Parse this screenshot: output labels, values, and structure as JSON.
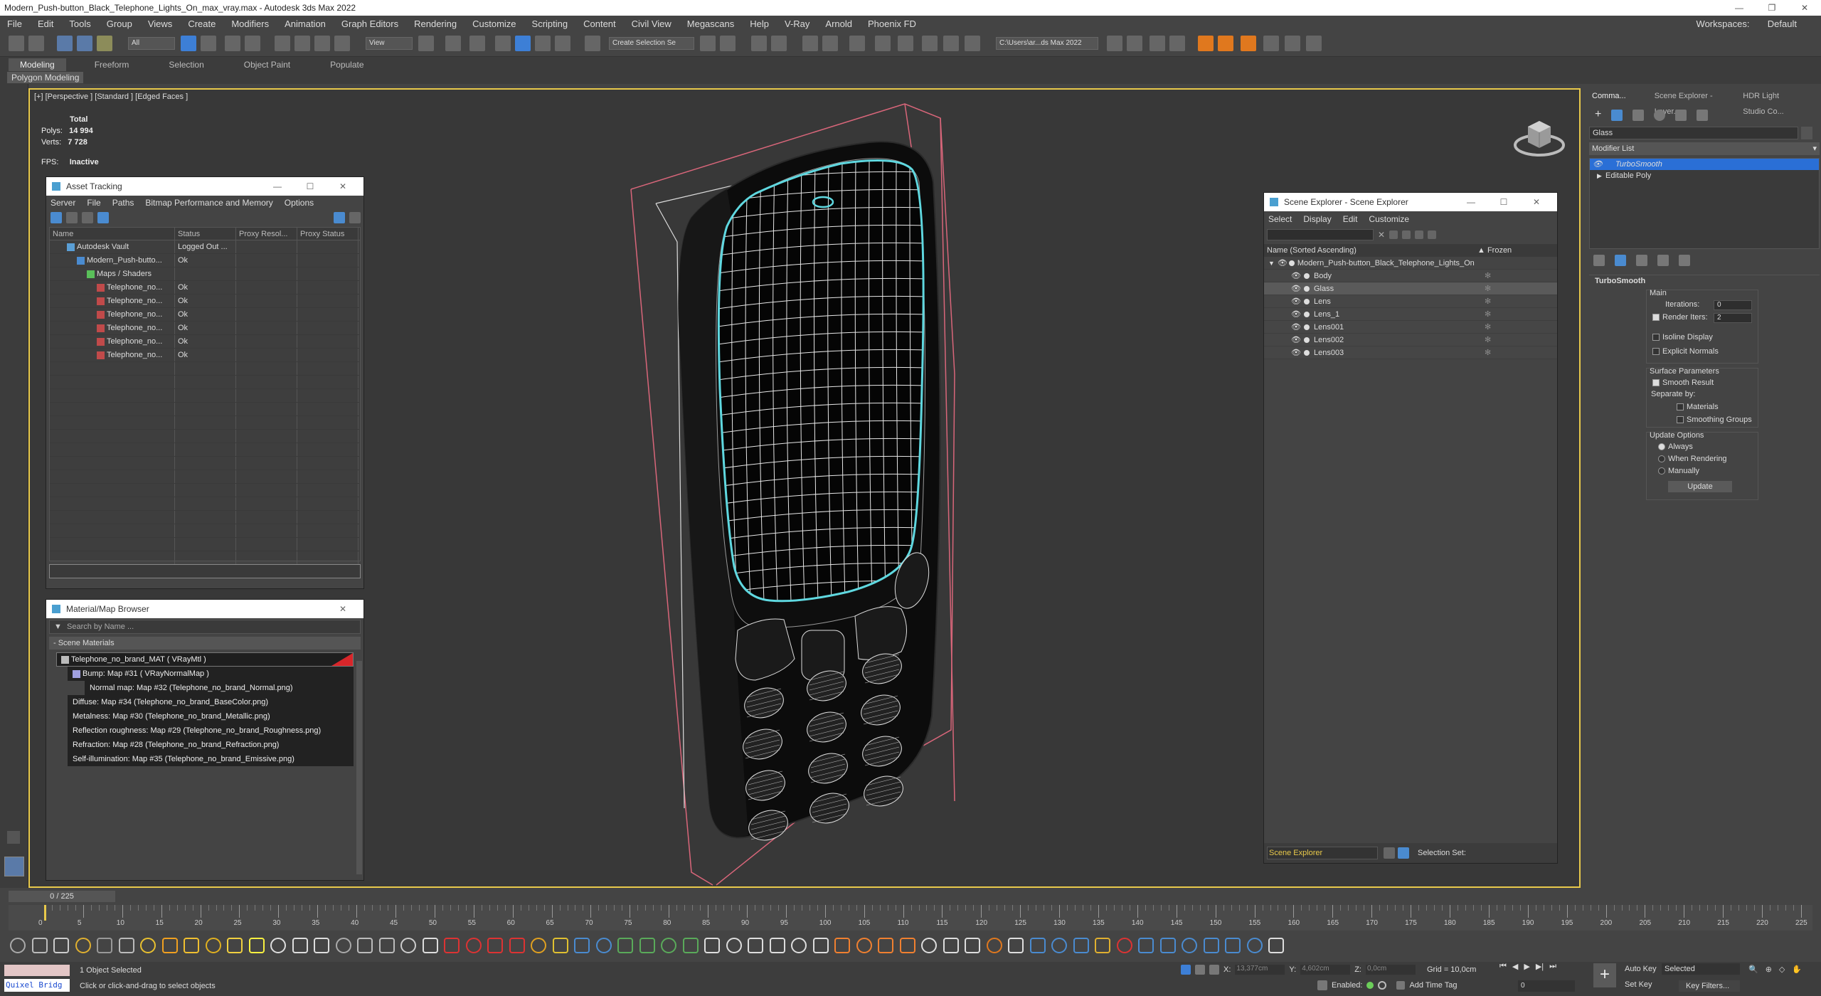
{
  "window": {
    "title": "Modern_Push-button_Black_Telephone_Lights_On_max_vray.max - Autodesk 3ds Max 2022",
    "workspace_label": "Workspaces:",
    "workspace_value": "Default"
  },
  "menu": [
    "File",
    "Edit",
    "Tools",
    "Group",
    "Views",
    "Create",
    "Modifiers",
    "Animation",
    "Graph Editors",
    "Rendering",
    "Customize",
    "Scripting",
    "Content",
    "Civil View",
    "Megascans",
    "Help",
    "V-Ray",
    "Arnold",
    "Phoenix FD"
  ],
  "toolbar": {
    "filter": "All",
    "refcoord": "View",
    "selset": "Create Selection Se",
    "path": "C:\\Users\\ar...ds Max 2022"
  },
  "ribbon": {
    "tabs": [
      "Modeling",
      "Freeform",
      "Selection",
      "Object Paint",
      "Populate"
    ],
    "active": "Modeling",
    "subtab": "Polygon Modeling"
  },
  "viewport": {
    "label": "[+] [Perspective ] [Standard ] [Edged Faces ]",
    "total": "Total",
    "polys_label": "Polys:",
    "polys": "14 994",
    "verts_label": "Verts:",
    "verts": "7 728",
    "fps_label": "FPS:",
    "fps": "Inactive"
  },
  "asset": {
    "title": "Asset Tracking",
    "menu": [
      "Server",
      "File",
      "Paths",
      "Bitmap Performance and Memory",
      "Options"
    ],
    "cols": [
      "Name",
      "Status",
      "Proxy Resol...",
      "Proxy Status"
    ],
    "rows": [
      {
        "name": "Autodesk Vault",
        "status": "Logged Out ...",
        "indent": 1
      },
      {
        "name": "Modern_Push-butto...",
        "status": "Ok",
        "indent": 2
      },
      {
        "name": "Maps / Shaders",
        "status": "",
        "indent": 3
      },
      {
        "name": "Telephone_no...",
        "status": "Ok",
        "indent": 4
      },
      {
        "name": "Telephone_no...",
        "status": "Ok",
        "indent": 4
      },
      {
        "name": "Telephone_no...",
        "status": "Ok",
        "indent": 4
      },
      {
        "name": "Telephone_no...",
        "status": "Ok",
        "indent": 4
      },
      {
        "name": "Telephone_no...",
        "status": "Ok",
        "indent": 4
      },
      {
        "name": "Telephone_no...",
        "status": "Ok",
        "indent": 4
      }
    ]
  },
  "matbrowser": {
    "title": "Material/Map Browser",
    "search": "Search by Name ...",
    "section": "- Scene Materials",
    "items": [
      "Telephone_no_brand_MAT ( VRayMtl )",
      "Bump: Map #31 ( VRayNormalMap )",
      "Normal map: Map #32 (Telephone_no_brand_Normal.png)",
      "Diffuse: Map #34 (Telephone_no_brand_BaseColor.png)",
      "Metalness: Map #30 (Telephone_no_brand_Metallic.png)",
      "Reflection roughness: Map #29 (Telephone_no_brand_Roughness.png)",
      "Refraction: Map #28 (Telephone_no_brand_Refraction.png)",
      "Self-illumination: Map #35 (Telephone_no_brand_Emissive.png)"
    ]
  },
  "scene": {
    "title": "Scene Explorer - Scene Explorer",
    "menu": [
      "Select",
      "Display",
      "Edit",
      "Customize"
    ],
    "col_name": "Name (Sorted Ascending)",
    "col_frozen": "▲ Frozen",
    "root": "Modern_Push-button_Black_Telephone_Lights_On",
    "children": [
      "Body",
      "Glass",
      "Lens",
      "Lens_1",
      "Lens001",
      "Lens002",
      "Lens003"
    ],
    "selected": "Glass",
    "footer_name": "Scene Explorer",
    "footer_set": "Selection Set:"
  },
  "cmd": {
    "tabs": [
      "Comma...",
      "Scene Explorer - Layer...",
      "HDR Light Studio Co..."
    ],
    "object_name": "Glass",
    "modlist": "Modifier List",
    "stack": [
      "TurboSmooth",
      "Editable Poly"
    ],
    "ts": {
      "title": "TurboSmooth",
      "main": "Main",
      "iter_label": "Iterations:",
      "iter": "0",
      "render_label": "Render Iters:",
      "render": "2",
      "isoline": "Isoline Display",
      "explicit": "Explicit Normals",
      "surface": "Surface Parameters",
      "smooth": "Smooth Result",
      "sepby": "Separate by:",
      "materials": "Materials",
      "smgroups": "Smoothing Groups",
      "update_opts": "Update Options",
      "always": "Always",
      "whenrender": "When Rendering",
      "manually": "Manually",
      "update_btn": "Update"
    }
  },
  "timeline": {
    "frame": "0 / 225",
    "ticks": [
      "0",
      "5",
      "10",
      "15",
      "20",
      "25",
      "30",
      "35",
      "40",
      "45",
      "50",
      "55",
      "60",
      "65",
      "70",
      "75",
      "80",
      "85",
      "90",
      "95",
      "100",
      "105",
      "110",
      "115",
      "120",
      "125",
      "130",
      "135",
      "140",
      "145",
      "150",
      "155",
      "160",
      "165",
      "170",
      "175",
      "180",
      "185",
      "190",
      "195",
      "200",
      "205",
      "210",
      "215",
      "220",
      "225"
    ]
  },
  "status": {
    "script": "Quixel Bridg",
    "selected": "1 Object Selected",
    "hint": "Click or click-and-drag to select objects",
    "x_label": "X:",
    "x": "13,377cm",
    "y_label": "Y:",
    "y": "4,602cm",
    "z_label": "Z:",
    "z": "0,0cm",
    "grid": "Grid = 10,0cm",
    "enabled": "Enabled:",
    "addtag": "Add Time Tag",
    "autokey": "Auto Key",
    "selected_dd": "Selected",
    "setkey": "Set Key",
    "keyfilters": "Key Filters...",
    "frame_field": "0"
  },
  "colors": {
    "accent": "#e8c94b",
    "selection": "#2a6fd6",
    "teal": "#5fd8e0",
    "box": "#d9667a"
  }
}
